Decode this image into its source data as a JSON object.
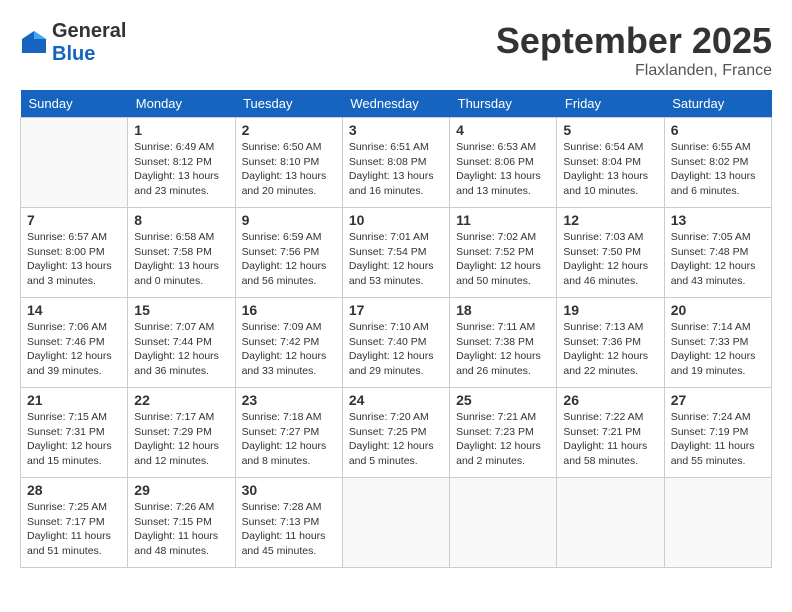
{
  "logo": {
    "general": "General",
    "blue": "Blue"
  },
  "header": {
    "month": "September 2025",
    "location": "Flaxlanden, France"
  },
  "weekdays": [
    "Sunday",
    "Monday",
    "Tuesday",
    "Wednesday",
    "Thursday",
    "Friday",
    "Saturday"
  ],
  "weeks": [
    [
      {
        "day": "",
        "info": ""
      },
      {
        "day": "1",
        "info": "Sunrise: 6:49 AM\nSunset: 8:12 PM\nDaylight: 13 hours\nand 23 minutes."
      },
      {
        "day": "2",
        "info": "Sunrise: 6:50 AM\nSunset: 8:10 PM\nDaylight: 13 hours\nand 20 minutes."
      },
      {
        "day": "3",
        "info": "Sunrise: 6:51 AM\nSunset: 8:08 PM\nDaylight: 13 hours\nand 16 minutes."
      },
      {
        "day": "4",
        "info": "Sunrise: 6:53 AM\nSunset: 8:06 PM\nDaylight: 13 hours\nand 13 minutes."
      },
      {
        "day": "5",
        "info": "Sunrise: 6:54 AM\nSunset: 8:04 PM\nDaylight: 13 hours\nand 10 minutes."
      },
      {
        "day": "6",
        "info": "Sunrise: 6:55 AM\nSunset: 8:02 PM\nDaylight: 13 hours\nand 6 minutes."
      }
    ],
    [
      {
        "day": "7",
        "info": "Sunrise: 6:57 AM\nSunset: 8:00 PM\nDaylight: 13 hours\nand 3 minutes."
      },
      {
        "day": "8",
        "info": "Sunrise: 6:58 AM\nSunset: 7:58 PM\nDaylight: 13 hours\nand 0 minutes."
      },
      {
        "day": "9",
        "info": "Sunrise: 6:59 AM\nSunset: 7:56 PM\nDaylight: 12 hours\nand 56 minutes."
      },
      {
        "day": "10",
        "info": "Sunrise: 7:01 AM\nSunset: 7:54 PM\nDaylight: 12 hours\nand 53 minutes."
      },
      {
        "day": "11",
        "info": "Sunrise: 7:02 AM\nSunset: 7:52 PM\nDaylight: 12 hours\nand 50 minutes."
      },
      {
        "day": "12",
        "info": "Sunrise: 7:03 AM\nSunset: 7:50 PM\nDaylight: 12 hours\nand 46 minutes."
      },
      {
        "day": "13",
        "info": "Sunrise: 7:05 AM\nSunset: 7:48 PM\nDaylight: 12 hours\nand 43 minutes."
      }
    ],
    [
      {
        "day": "14",
        "info": "Sunrise: 7:06 AM\nSunset: 7:46 PM\nDaylight: 12 hours\nand 39 minutes."
      },
      {
        "day": "15",
        "info": "Sunrise: 7:07 AM\nSunset: 7:44 PM\nDaylight: 12 hours\nand 36 minutes."
      },
      {
        "day": "16",
        "info": "Sunrise: 7:09 AM\nSunset: 7:42 PM\nDaylight: 12 hours\nand 33 minutes."
      },
      {
        "day": "17",
        "info": "Sunrise: 7:10 AM\nSunset: 7:40 PM\nDaylight: 12 hours\nand 29 minutes."
      },
      {
        "day": "18",
        "info": "Sunrise: 7:11 AM\nSunset: 7:38 PM\nDaylight: 12 hours\nand 26 minutes."
      },
      {
        "day": "19",
        "info": "Sunrise: 7:13 AM\nSunset: 7:36 PM\nDaylight: 12 hours\nand 22 minutes."
      },
      {
        "day": "20",
        "info": "Sunrise: 7:14 AM\nSunset: 7:33 PM\nDaylight: 12 hours\nand 19 minutes."
      }
    ],
    [
      {
        "day": "21",
        "info": "Sunrise: 7:15 AM\nSunset: 7:31 PM\nDaylight: 12 hours\nand 15 minutes."
      },
      {
        "day": "22",
        "info": "Sunrise: 7:17 AM\nSunset: 7:29 PM\nDaylight: 12 hours\nand 12 minutes."
      },
      {
        "day": "23",
        "info": "Sunrise: 7:18 AM\nSunset: 7:27 PM\nDaylight: 12 hours\nand 8 minutes."
      },
      {
        "day": "24",
        "info": "Sunrise: 7:20 AM\nSunset: 7:25 PM\nDaylight: 12 hours\nand 5 minutes."
      },
      {
        "day": "25",
        "info": "Sunrise: 7:21 AM\nSunset: 7:23 PM\nDaylight: 12 hours\nand 2 minutes."
      },
      {
        "day": "26",
        "info": "Sunrise: 7:22 AM\nSunset: 7:21 PM\nDaylight: 11 hours\nand 58 minutes."
      },
      {
        "day": "27",
        "info": "Sunrise: 7:24 AM\nSunset: 7:19 PM\nDaylight: 11 hours\nand 55 minutes."
      }
    ],
    [
      {
        "day": "28",
        "info": "Sunrise: 7:25 AM\nSunset: 7:17 PM\nDaylight: 11 hours\nand 51 minutes."
      },
      {
        "day": "29",
        "info": "Sunrise: 7:26 AM\nSunset: 7:15 PM\nDaylight: 11 hours\nand 48 minutes."
      },
      {
        "day": "30",
        "info": "Sunrise: 7:28 AM\nSunset: 7:13 PM\nDaylight: 11 hours\nand 45 minutes."
      },
      {
        "day": "",
        "info": ""
      },
      {
        "day": "",
        "info": ""
      },
      {
        "day": "",
        "info": ""
      },
      {
        "day": "",
        "info": ""
      }
    ]
  ]
}
